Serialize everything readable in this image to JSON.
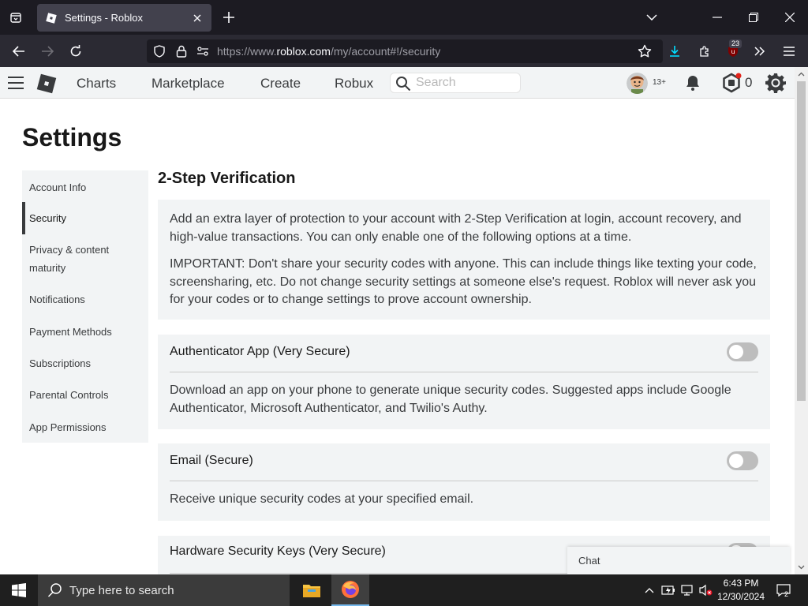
{
  "browser": {
    "tab_title": "Settings - Roblox",
    "url_prefix": "https://www.",
    "url_domain": "roblox.com",
    "url_path": "/my/account#!/security",
    "extension_badge": "23"
  },
  "header": {
    "nav": [
      "Charts",
      "Marketplace",
      "Create",
      "Robux"
    ],
    "search_placeholder": "Search",
    "age_badge": "13+",
    "robux_count": "0"
  },
  "page": {
    "title": "Settings"
  },
  "sidebar": {
    "items": [
      {
        "label": "Account Info",
        "active": false
      },
      {
        "label": "Security",
        "active": true
      },
      {
        "label": "Privacy & content maturity",
        "active": false
      },
      {
        "label": "Notifications",
        "active": false
      },
      {
        "label": "Payment Methods",
        "active": false
      },
      {
        "label": "Subscriptions",
        "active": false
      },
      {
        "label": "Parental Controls",
        "active": false
      },
      {
        "label": "App Permissions",
        "active": false
      }
    ]
  },
  "security": {
    "heading": "2-Step Verification",
    "intro_1": "Add an extra layer of protection to your account with 2-Step Verification at login, account recovery, and high-value transactions. You can only enable one of the following options at a time.",
    "intro_2": "IMPORTANT: Don't share your security codes with anyone. This can include things like texting your code, screensharing, etc. Do not change security settings at someone else's request. Roblox will never ask you for your codes or to change settings to prove account ownership.",
    "options": [
      {
        "label": "Authenticator App (Very Secure)",
        "enabled": false,
        "description": "Download an app on your phone to generate unique security codes. Suggested apps include Google Authenticator, Microsoft Authenticator, and Twilio's Authy."
      },
      {
        "label": "Email (Secure)",
        "enabled": false,
        "description": "Receive unique security codes at your specified email."
      },
      {
        "label": "Hardware Security Keys (Very Secure)",
        "enabled": false
      }
    ]
  },
  "chat": {
    "label": "Chat"
  },
  "taskbar": {
    "search_placeholder": "Type here to search",
    "time": "6:43 PM",
    "date": "12/30/2024",
    "notification_count": "2"
  },
  "colors": {
    "browser_dark": "#1c1b22",
    "browser_toolbar": "#2b2a33",
    "roblox_panel": "#f2f4f5",
    "toggle_off": "#bdbdbd",
    "download_accent": "#0df"
  }
}
